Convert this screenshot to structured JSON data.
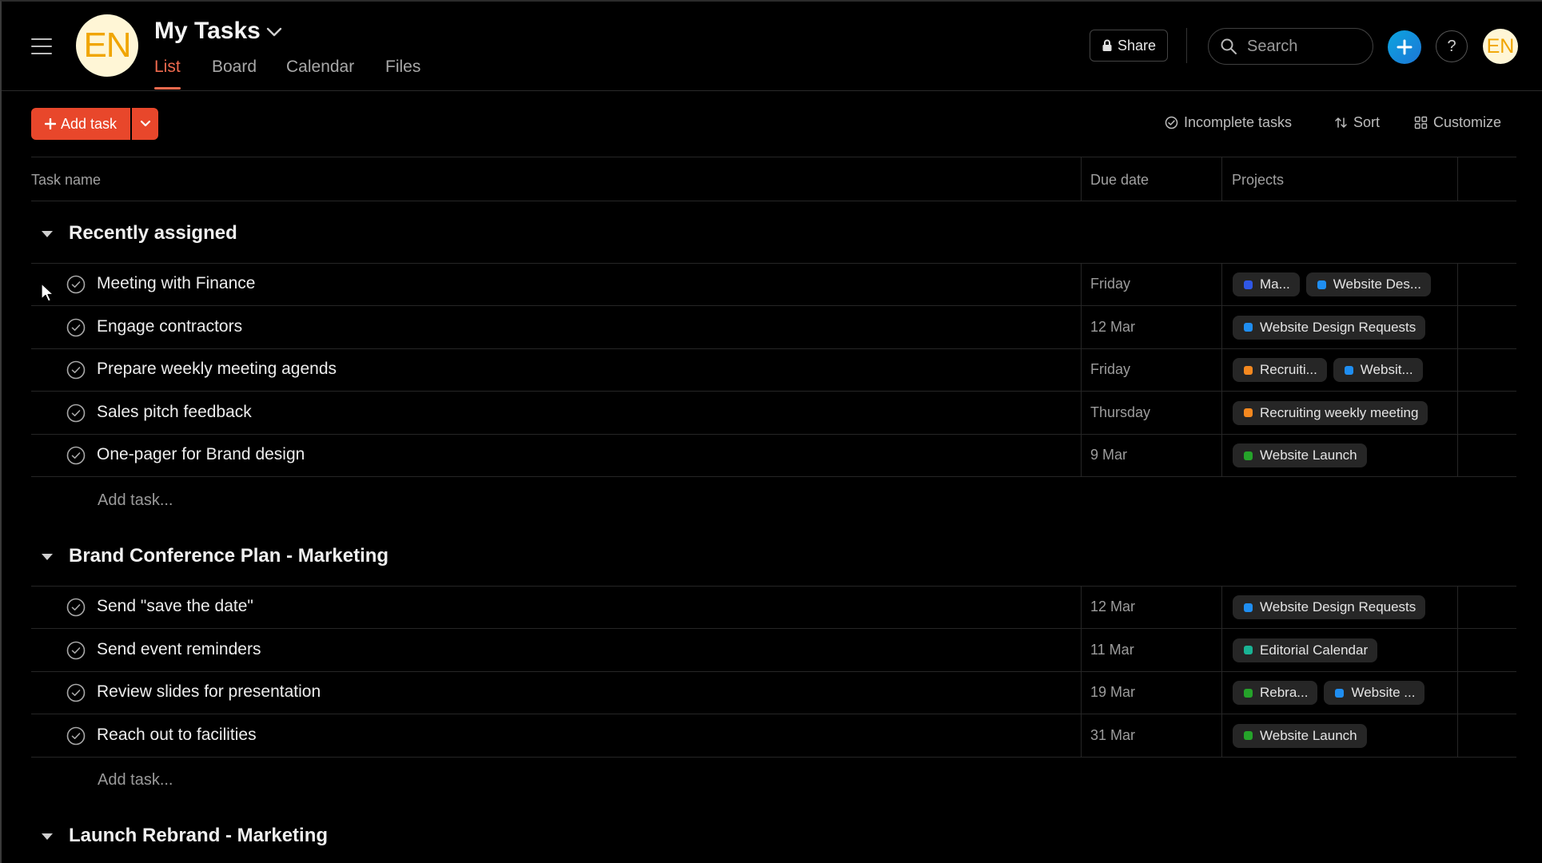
{
  "header": {
    "avatar_initials": "EN",
    "title": "My Tasks",
    "tabs": [
      {
        "label": "List",
        "active": true
      },
      {
        "label": "Board",
        "active": false
      },
      {
        "label": "Calendar",
        "active": false
      },
      {
        "label": "Files",
        "active": false
      }
    ],
    "share_label": "Share",
    "search_placeholder": "Search",
    "help_label": "?",
    "user_initials": "EN"
  },
  "toolbar": {
    "add_task_label": "Add task",
    "filter_label": "Incomplete tasks",
    "sort_label": "Sort",
    "customize_label": "Customize"
  },
  "table": {
    "columns": [
      "Task name",
      "Due date",
      "Projects"
    ]
  },
  "colors": {
    "accent": "#e8472b",
    "active_tab": "#f06a4e",
    "blue": "#1f8ef1",
    "navy_blue": "#2f57e6",
    "orange": "#f4881f",
    "green": "#25a32a",
    "teal": "#19b394"
  },
  "sections": [
    {
      "title": "Recently assigned",
      "add_label": "Add task...",
      "tasks": [
        {
          "name": "Meeting with Finance",
          "due": "Friday",
          "projects": [
            {
              "label": "Ma...",
              "color": "#2f57e6"
            },
            {
              "label": "Website Des...",
              "color": "#1f8ef1"
            }
          ]
        },
        {
          "name": "Engage contractors",
          "due": "12 Mar",
          "projects": [
            {
              "label": "Website Design Requests",
              "color": "#1f8ef1"
            }
          ]
        },
        {
          "name": "Prepare weekly meeting agends",
          "due": "Friday",
          "projects": [
            {
              "label": "Recruiti...",
              "color": "#f4881f"
            },
            {
              "label": "Websit...",
              "color": "#1f8ef1"
            }
          ]
        },
        {
          "name": "Sales pitch feedback",
          "due": "Thursday",
          "projects": [
            {
              "label": "Recruiting weekly meeting",
              "color": "#f4881f"
            }
          ]
        },
        {
          "name": "One-pager for Brand design",
          "due": "9 Mar",
          "projects": [
            {
              "label": "Website Launch",
              "color": "#25a32a"
            }
          ]
        }
      ]
    },
    {
      "title": "Brand Conference Plan - Marketing",
      "add_label": "Add task...",
      "tasks": [
        {
          "name": "Send \"save the date\"",
          "due": "12 Mar",
          "projects": [
            {
              "label": "Website Design Requests",
              "color": "#1f8ef1"
            }
          ]
        },
        {
          "name": "Send event reminders",
          "due": "11 Mar",
          "projects": [
            {
              "label": "Editorial Calendar",
              "color": "#19b394"
            }
          ]
        },
        {
          "name": "Review slides for presentation",
          "due": "19 Mar",
          "projects": [
            {
              "label": "Rebra...",
              "color": "#25a32a"
            },
            {
              "label": "Website ...",
              "color": "#1f8ef1"
            }
          ]
        },
        {
          "name": "Reach out to facilities",
          "due": "31 Mar",
          "projects": [
            {
              "label": "Website Launch",
              "color": "#25a32a"
            }
          ]
        }
      ]
    },
    {
      "title": "Launch Rebrand - Marketing",
      "tasks": []
    }
  ]
}
